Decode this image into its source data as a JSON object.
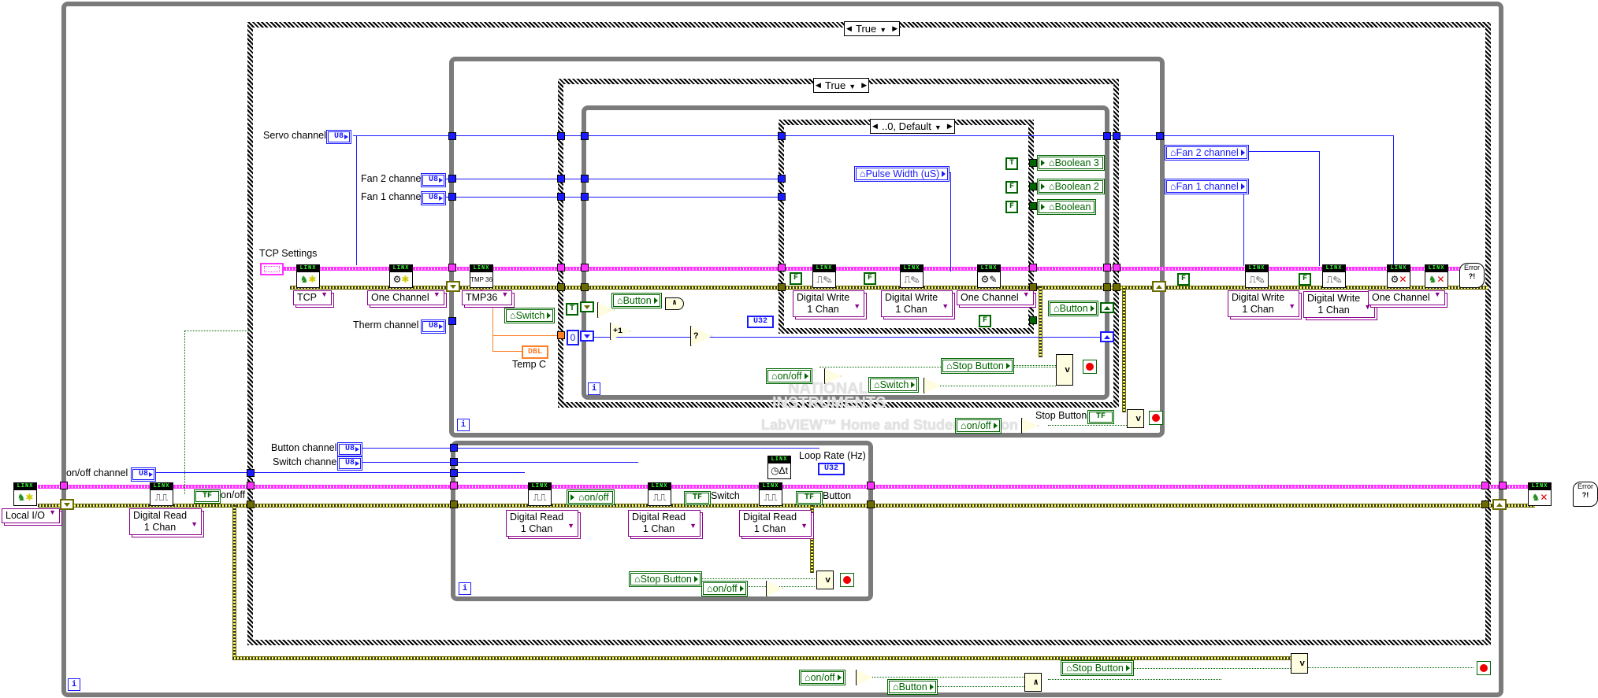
{
  "case_structures": {
    "outer_selector": "True",
    "inner_selector": "True",
    "innermost_selector": "..0, Default"
  },
  "controls": {
    "servo_channel": {
      "label": "Servo  channel",
      "type": "U8"
    },
    "fan2_channel": {
      "label": "Fan 2 channel",
      "type": "U8"
    },
    "fan1_channel": {
      "label": "Fan 1 channel",
      "type": "U8"
    },
    "therm_channel": {
      "label": "Therm  channel",
      "type": "U8"
    },
    "onoff_channel": {
      "label": "on/off channel",
      "type": "U8"
    },
    "button_channel": {
      "label": "Button channel",
      "type": "U8"
    },
    "switch_channel": {
      "label": "Switch channel",
      "type": "U8"
    },
    "tcp_settings": {
      "label": "TCP Settings"
    }
  },
  "linx_vis": {
    "header": "LINX",
    "local_io_ring": "Local I/O",
    "tcp_ring": "TCP",
    "servo_open_ring": "One Channel",
    "tmp36_ring": "TMP36",
    "digital_read_ring": "Digital Read\n1 Chan",
    "digital_read_label_1": "Digital Read",
    "digital_read_label_2": "1 Chan",
    "digital_write_label_1": "Digital Write",
    "digital_write_label_2": "1 Chan",
    "servo_write_ring": "One Channel",
    "servo_close_ring": "One Channel",
    "tmp_icon_text": "TMP 36"
  },
  "indicators": {
    "onoff_top": {
      "label": "on/off",
      "type": "TF"
    },
    "temp_c": {
      "label": "Temp C",
      "type": "DBL"
    },
    "loop_rate": {
      "label": "Loop Rate (Hz)",
      "type": "U32"
    },
    "switch": {
      "label": "Switch",
      "type": "TF"
    },
    "button": {
      "label": "Button",
      "type": "TF"
    },
    "stop_button": {
      "label": "Stop Button",
      "type": "TF"
    },
    "counter_out": {
      "type": "U32"
    }
  },
  "local_vars": {
    "switch": "Switch",
    "button": "Button",
    "pulse_width": "Pulse Width (uS)",
    "boolean3": "Boolean 3",
    "boolean2": "Boolean 2",
    "boolean": "Boolean",
    "onoff": "on/off",
    "stop_button": "Stop Button",
    "fan2_channel": "Fan 2 channel",
    "fan1_channel": "Fan 1 channel"
  },
  "constants": {
    "true": "T",
    "false": "F",
    "zero": "0",
    "tf": "TF",
    "u8": "U8",
    "u32": "U32",
    "dbl": "DBL",
    "increment": "+1",
    "and": "∧",
    "or": "v",
    "not": "¬"
  },
  "error_handler": {
    "text_1": "Error",
    "text_2": "?!"
  },
  "iteration_terminal": "i",
  "watermark": {
    "line1": "NATIONAL",
    "line2": "INSTRUMENTS",
    "line3": "LabVIEW™ Home and Student Edition"
  },
  "colors": {
    "integer_wire": "#1a1aff",
    "boolean_wire": "#006400",
    "cluster_wire": "#ff33ff",
    "error_wire": "#6b6b00",
    "float_wire": "#ff7f27",
    "structure_frame": "#7b7b7b",
    "vi_ring": "#8b008b"
  }
}
